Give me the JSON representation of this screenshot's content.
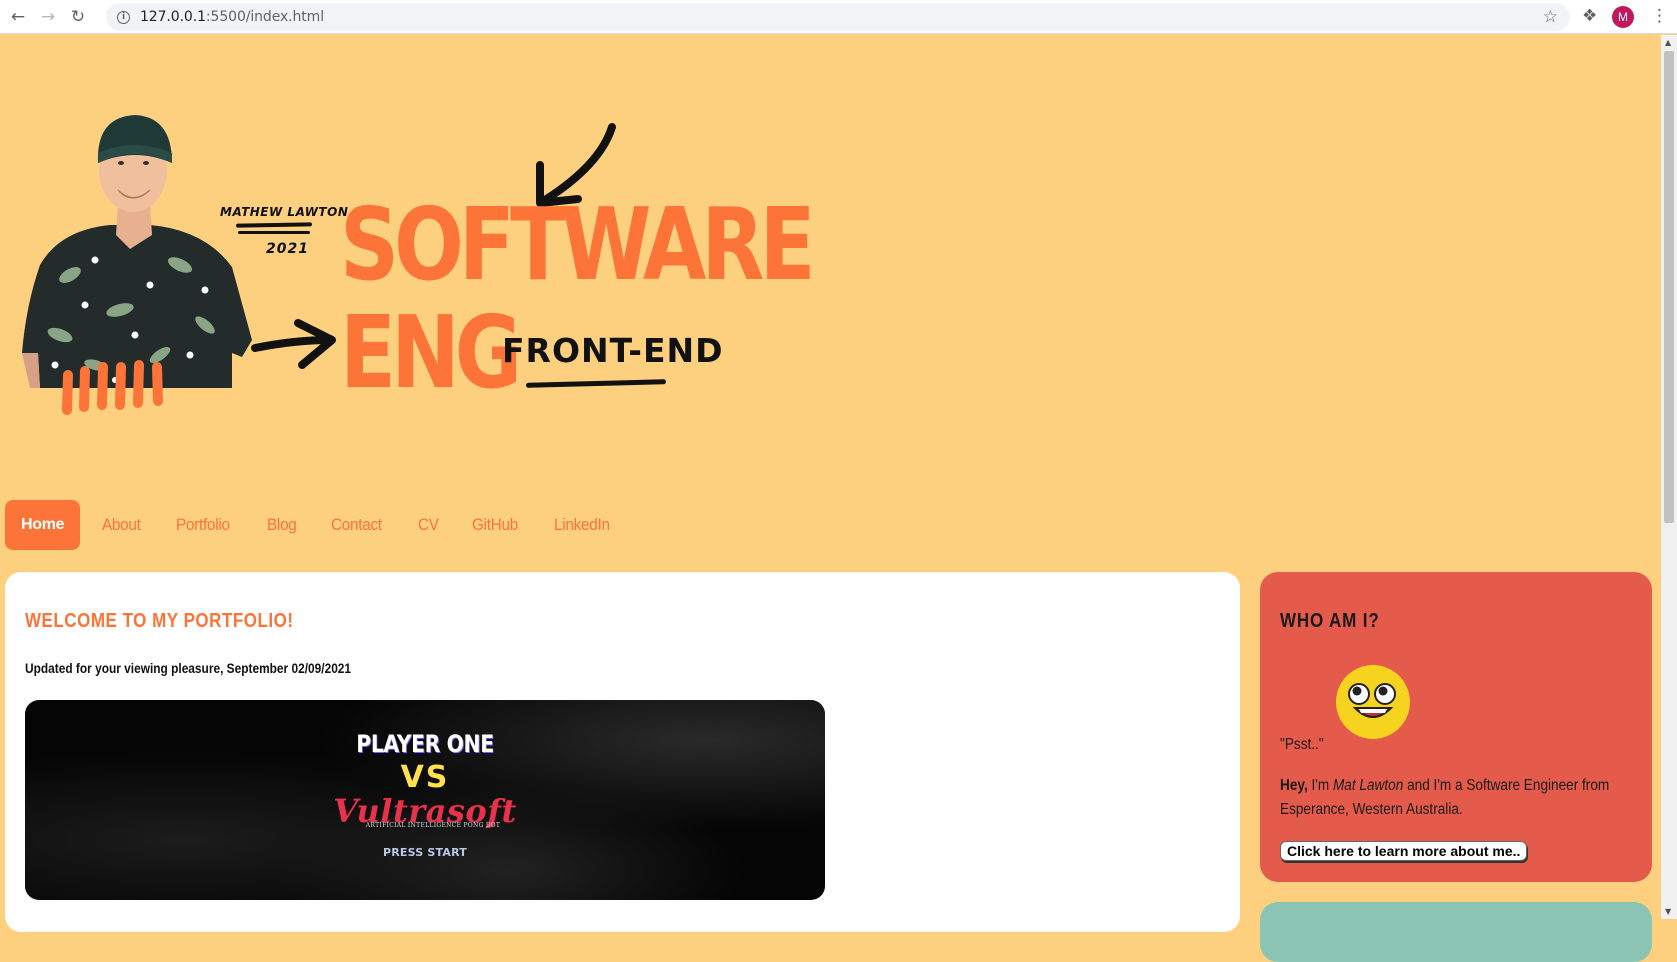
{
  "browser": {
    "url_host": "127.0.0.1",
    "url_rest": ":5500/index.html",
    "profile_initial": "M"
  },
  "hero": {
    "signature_name": "MATHEW LAWTON",
    "signature_year": "2021",
    "title_line1": "SOFTWARE",
    "title_line2": "ENG",
    "subtitle": "FRONT-END"
  },
  "nav": {
    "items": [
      {
        "label": "Home",
        "active": true
      },
      {
        "label": "About",
        "active": false
      },
      {
        "label": "Portfolio",
        "active": false
      },
      {
        "label": "Blog",
        "active": false
      },
      {
        "label": "Contact",
        "active": false
      },
      {
        "label": "CV",
        "active": false
      },
      {
        "label": "GitHub",
        "active": false
      },
      {
        "label": "LinkedIn",
        "active": false
      }
    ]
  },
  "main": {
    "title": "WELCOME TO MY PORTFOLIO!",
    "updated_text": "Updated for your viewing pleasure, September 02/09/2021",
    "banner": {
      "line1": "PLAYER ONE",
      "line2": "VS",
      "line3": "Vultrasoft",
      "line4": "ARTIFICIAL INTELLIGENCE PONG BOT",
      "line5": "PRESS START"
    }
  },
  "side": {
    "title": "WHO AM I?",
    "psst": "\"Psst..\"",
    "intro_bold": "Hey,",
    "intro_a": " I'm ",
    "intro_name": "Mat Lawton",
    "intro_b": " and I'm a Software Engineer from Esperance, Western Australia.",
    "button_label": "Click here to learn more about me.."
  },
  "colors": {
    "page_bg": "#fcd07f",
    "accent_orange": "#fd7438",
    "side_card_red": "#e45a4b",
    "side_card_teal": "#8cc4b4"
  }
}
